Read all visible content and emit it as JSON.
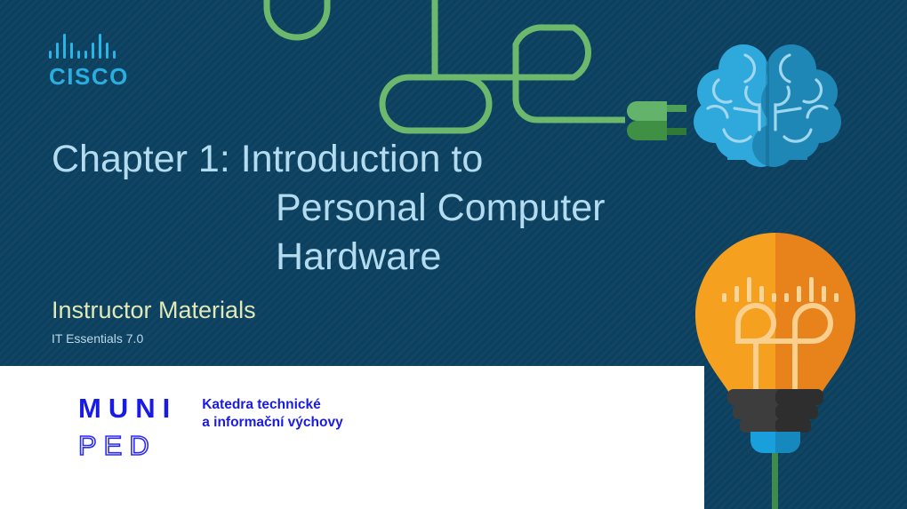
{
  "slide": {
    "background_color": "#0c405f",
    "title_lines": [
      "Chapter 1: Introduction to",
      "Personal Computer",
      "Hardware"
    ],
    "subtitle": "Instructor Materials",
    "course": "IT Essentials 7.0"
  },
  "cisco_logo": {
    "wordmark": "CISCO",
    "bar_color": "#27b6e8",
    "word_color": "#2aaee0",
    "bar_pattern": [
      "s",
      "m",
      "t",
      "m",
      "s",
      "s",
      "m",
      "t",
      "m",
      "s"
    ]
  },
  "muni_logo": {
    "primary": "MUNI",
    "secondary": "PED",
    "department_line1": "Katedra technické",
    "department_line2": "a informační výchovy",
    "color": "#1a1ae6"
  },
  "graphics": {
    "cable_color": "#6cb86c",
    "plug_top_color": "#63b36a",
    "plug_bottom_color": "#3f8f45",
    "brain_left_color": "#2fa8dc",
    "brain_right_color": "#1f87b5",
    "brain_fold_color": "#9fd7ee",
    "bulb_left_color": "#f5a01f",
    "bulb_right_color": "#e8821b",
    "bulb_filament_color": "#fbcf8e",
    "bulb_base_color": "#3d3d3d",
    "bulb_tip_color": "#199fdb",
    "stem_color": "#3e8b4e"
  },
  "icon_names": {
    "cisco": "cisco-logo-icon",
    "brain": "brain-icon",
    "bulb": "lightbulb-icon",
    "plug": "power-plug-icon",
    "cable": "cable-path-icon"
  }
}
